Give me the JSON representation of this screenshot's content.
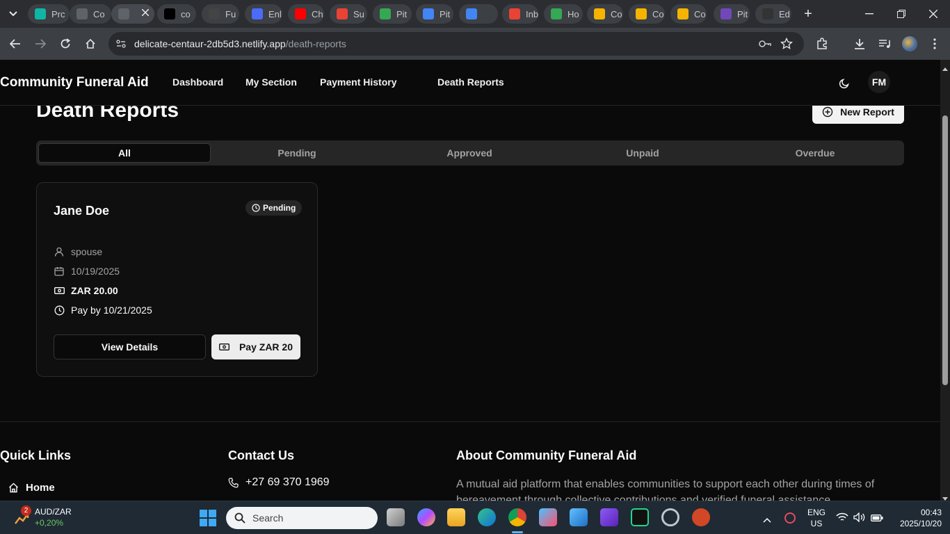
{
  "browser": {
    "tabs": [
      {
        "label": "Prc",
        "color": "#0fb6a4"
      },
      {
        "label": "Co",
        "color": "#5f6368"
      },
      {
        "label": "",
        "color": "#5f6368"
      },
      {
        "label": "co",
        "color": "#000000"
      },
      {
        "label": "Fu",
        "color": "#444444"
      },
      {
        "label": "Enl",
        "color": "#4b6bfb"
      },
      {
        "label": "Ch",
        "color": "#ff0000"
      },
      {
        "label": "Su",
        "color": "#ea4335"
      },
      {
        "label": "Pit",
        "color": "#34a853"
      },
      {
        "label": "Pit",
        "color": "#4285f4"
      },
      {
        "label": "",
        "color": "#4285f4"
      },
      {
        "label": "Inb",
        "color": "#ea4335"
      },
      {
        "label": "Ho",
        "color": "#34a853"
      },
      {
        "label": "Co",
        "color": "#f4b400"
      },
      {
        "label": "Co",
        "color": "#f4b400"
      },
      {
        "label": "Co",
        "color": "#f4b400"
      },
      {
        "label": "Pit",
        "color": "#7248b9"
      },
      {
        "label": "Ed",
        "color": "#333333"
      }
    ],
    "url_host": "delicate-centaur-2db5d3.netlify.app",
    "url_path": "/death-reports"
  },
  "app": {
    "brand": "Community Funeral Aid",
    "nav": [
      "Dashboard",
      "My Section",
      "Payment History",
      "Death Reports"
    ],
    "avatar": "FM",
    "page_title": "Death Reports",
    "new_report_label": "New Report",
    "filter_tabs": [
      "All",
      "Pending",
      "Approved",
      "Unpaid",
      "Overdue"
    ],
    "card": {
      "name": "Jane Doe",
      "status": "Pending",
      "relation": "spouse",
      "date": "10/19/2025",
      "amount": "ZAR 20.00",
      "due": "Pay by 10/21/2025",
      "view_label": "View Details",
      "pay_label": "Pay ZAR 20"
    },
    "footer": {
      "quick_links_title": "Quick Links",
      "quick_links": [
        "Home"
      ],
      "contact_title": "Contact Us",
      "phone": "+27 69 370 1969",
      "about_title": "About Community Funeral Aid",
      "about_text": "A mutual aid platform that enables communities to support each other during times of bereavement through collective contributions and verified funeral assistance."
    }
  },
  "taskbar": {
    "stock_badge": "2",
    "stock_name": "AUD/ZAR",
    "stock_change": "+0,20%",
    "search_placeholder": "Search",
    "lang_top": "ENG",
    "lang_bottom": "US",
    "time": "00:43",
    "date": "2025/10/20"
  }
}
